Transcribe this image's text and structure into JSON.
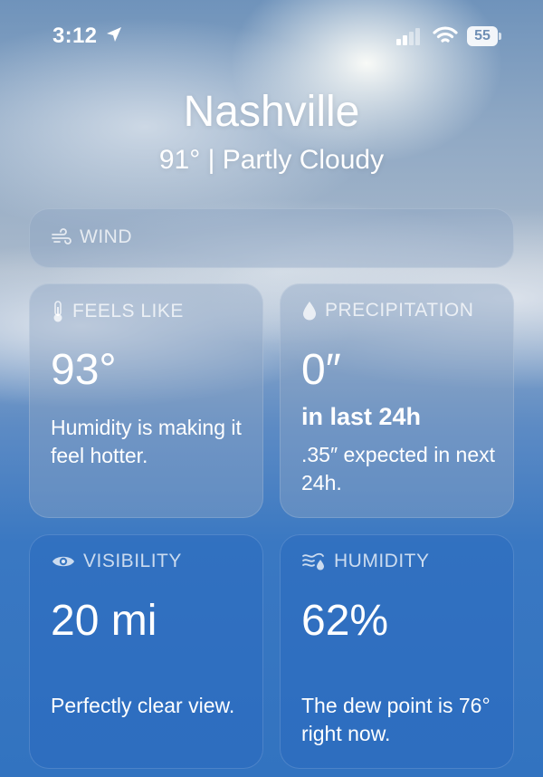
{
  "status_bar": {
    "time": "3:12",
    "battery": "55"
  },
  "location": {
    "city": "Nashville",
    "summary": "91°  |  Partly Cloudy"
  },
  "wind": {
    "label": "WIND"
  },
  "feels_like": {
    "label": "FEELS LIKE",
    "value": "93°",
    "description": "Humidity is making it feel hotter."
  },
  "precipitation": {
    "label": "PRECIPITATION",
    "value": "0″",
    "period": "in last 24h",
    "description": ".35″ expected in next 24h."
  },
  "visibility": {
    "label": "VISIBILITY",
    "value": "20 mi",
    "description": "Perfectly clear view."
  },
  "humidity": {
    "label": "HUMIDITY",
    "value": "62%",
    "description": "The dew point is 76° right now."
  }
}
